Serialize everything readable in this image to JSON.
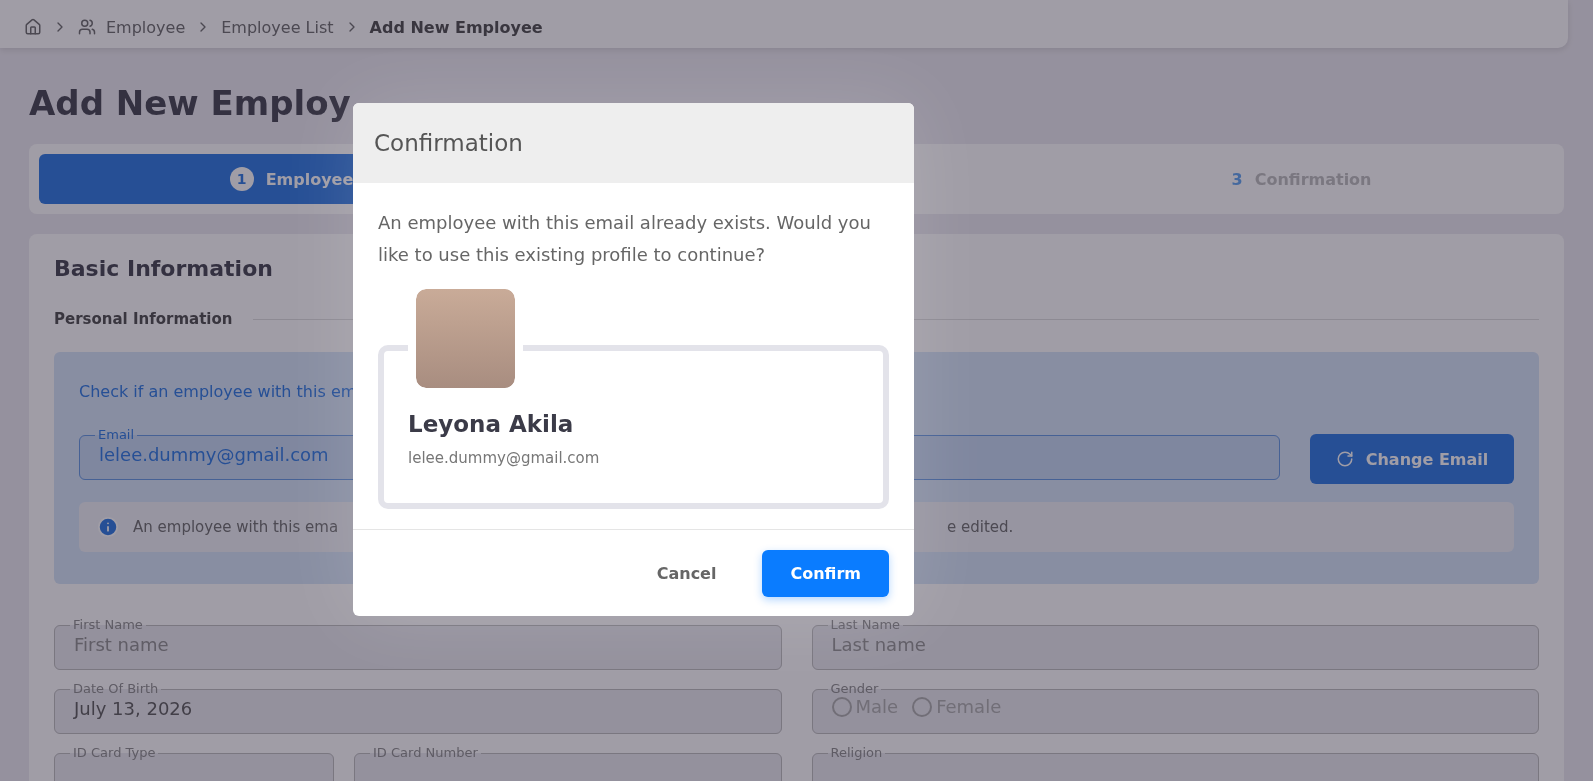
{
  "breadcrumb": [
    {
      "label": "Employee",
      "current": false
    },
    {
      "label": "Employee List",
      "current": false
    },
    {
      "label": "Add New Employee",
      "current": true
    }
  ],
  "page_title": "Add New Employ",
  "steps": [
    {
      "number": "1",
      "label": "Employee",
      "selected": true
    },
    {
      "number": "3",
      "label": "Confirmation",
      "selected": false
    }
  ],
  "section": {
    "title": "Basic Information",
    "subtitle": "Personal Information"
  },
  "lookup": {
    "prompt": "Check if an employee with this em",
    "email_label": "Email",
    "email_value": "lelee.dummy@gmail.com",
    "button": "Change Email",
    "notice_start": "An employee with this ema",
    "notice_end": "e edited."
  },
  "fields": [
    {
      "kind": "text",
      "label": "First Name",
      "placeholder": "First name"
    },
    {
      "kind": "text",
      "label": "Last Name",
      "placeholder": "Last name"
    },
    {
      "kind": "text",
      "label": "Date Of Birth",
      "value": "July 13, 2026"
    },
    {
      "kind": "radio",
      "label": "Gender",
      "options": [
        {
          "label": "Male",
          "selected": false
        },
        {
          "label": "Female",
          "selected": false
        }
      ]
    }
  ],
  "cut_fields": [
    "ID Card Type",
    "ID Card Number",
    "Religion"
  ],
  "dialog": {
    "title": "Confirmation",
    "message": "An employee with this email already exists. Would you like to use this existing profile to continue?",
    "profile": {
      "name": "Leyona Akila",
      "email": "lelee.dummy@gmail.com"
    },
    "buttons": [
      {
        "label": "Cancel",
        "kind": "text"
      },
      {
        "label": "Confirm",
        "kind": "primary"
      }
    ]
  }
}
